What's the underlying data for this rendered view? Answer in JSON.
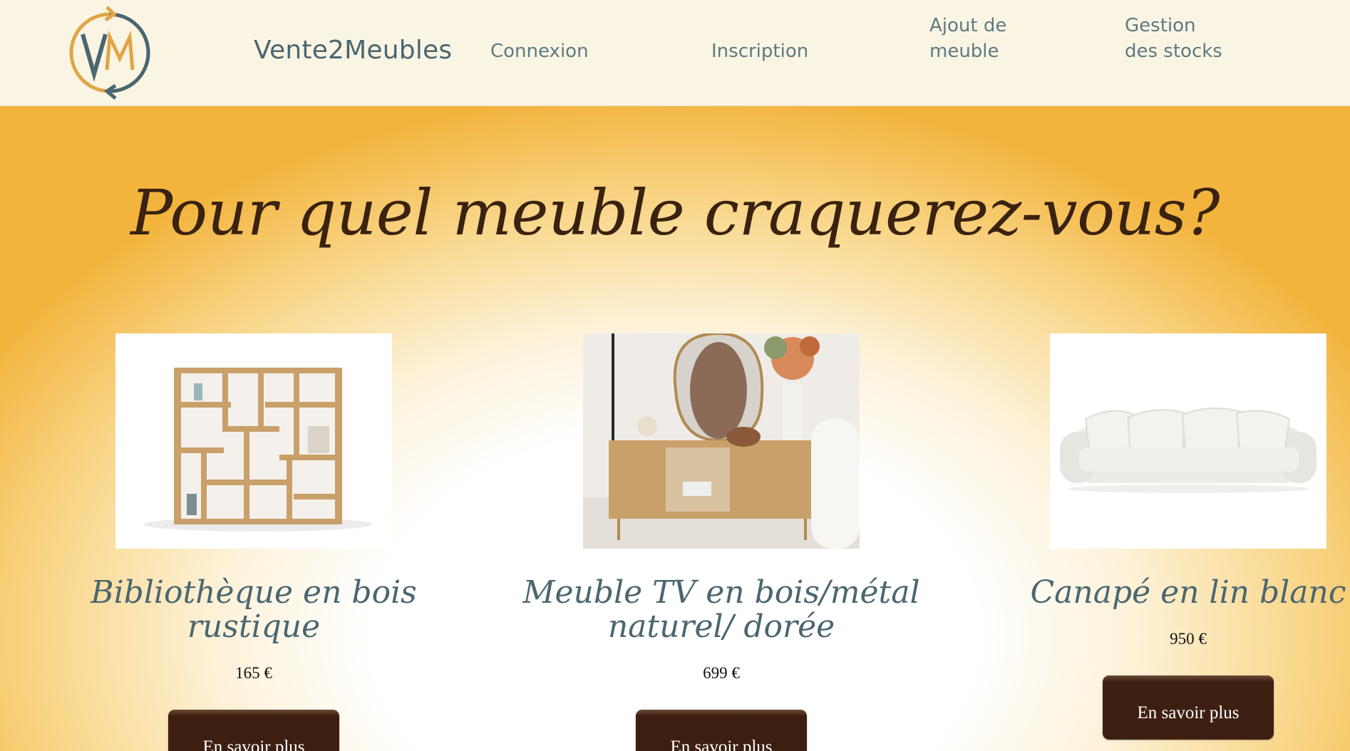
{
  "header": {
    "brand": "Vente2Meubles",
    "logo_text": "VM",
    "nav": {
      "login": "Connexion",
      "signup": "Inscription",
      "add_furniture": "Ajout de meuble",
      "stock_management": "Gestion des stocks"
    }
  },
  "hero": {
    "title": "Pour quel meuble craquerez-vous?"
  },
  "products": [
    {
      "name": "Bibliothèque en bois rustique",
      "price": "165 €",
      "button": "En savoir plus",
      "image_icon": "bookshelf-image"
    },
    {
      "name": "Meuble TV en bois/métal naturel/ dorée",
      "price": "699 €",
      "button": "En savoir plus",
      "image_icon": "tv-stand-image"
    },
    {
      "name": "Canapé en lin blanc",
      "price": "950 €",
      "button": "En savoir plus",
      "image_icon": "sofa-image"
    }
  ],
  "colors": {
    "header_bg": "#faf5e3",
    "brand_text": "#4a6670",
    "accent_orange": "#f3b43e",
    "title_text": "#3a2210",
    "button_bg": "#3d1f12"
  }
}
